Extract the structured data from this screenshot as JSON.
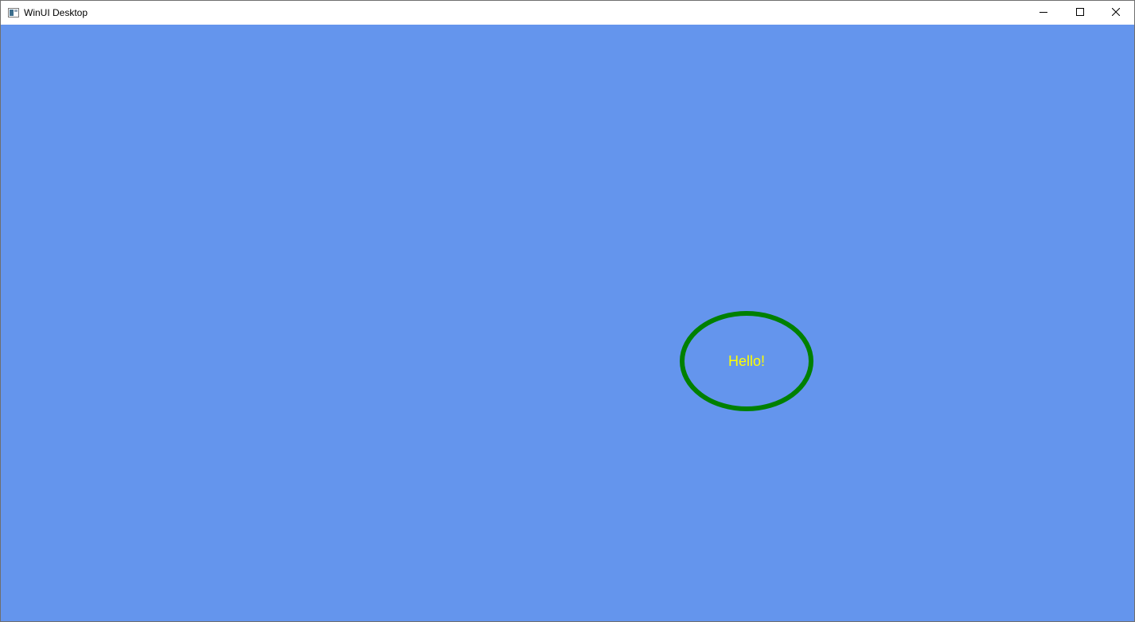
{
  "window": {
    "title": "WinUI Desktop",
    "icon": "app-window-icon",
    "caption_buttons": [
      "minimize-icon",
      "maximize-icon",
      "close-icon"
    ]
  },
  "content": {
    "background_color": "#6495ed",
    "shape": {
      "type": "ellipse",
      "stroke_color": "#008000",
      "text": "Hello!",
      "text_color": "#ffff00"
    }
  }
}
